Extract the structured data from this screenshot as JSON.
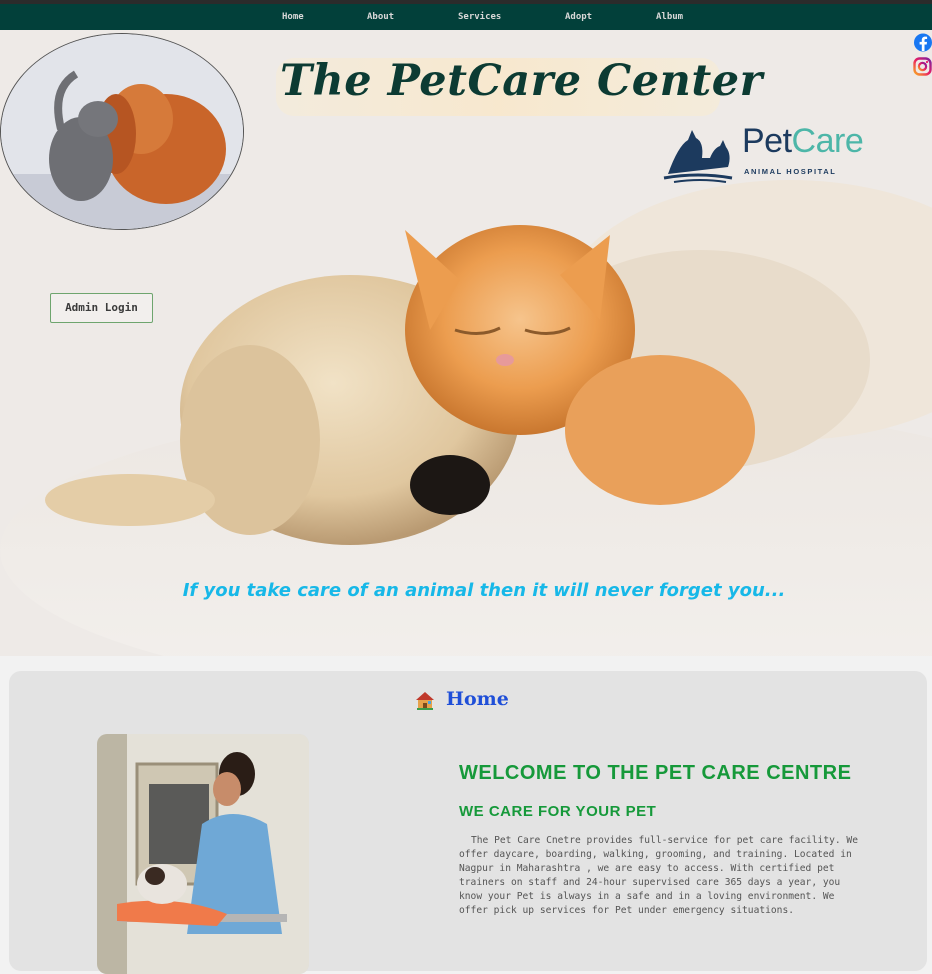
{
  "nav": {
    "items": [
      "Home",
      "About",
      "Services",
      "Adopt",
      "Album"
    ]
  },
  "header": {
    "title": "The PetCare Center",
    "logo_word_a": "Pet",
    "logo_word_b": "Care",
    "logo_sub": "ANIMAL HOSPITAL",
    "admin_login": "Admin Login",
    "tagline": "If you take care of an animal then it will never forget you..."
  },
  "colors": {
    "nav_bg": "#02403a",
    "title": "#0c3b33",
    "tagline": "#17b8e8",
    "section_title": "#1f4fd8",
    "welcome": "#16993a"
  },
  "social": [
    "facebook-icon",
    "instagram-icon"
  ],
  "main": {
    "section_title": "Home",
    "welcome_heading": "WELCOME TO THE PET CARE CENTRE",
    "welcome_sub": "WE CARE FOR YOUR PET",
    "description": "The Pet Care Cnetre provides full-service for pet care facility. We offer daycare, boarding, walking, grooming, and training. Located in Nagpur in Maharashtra , we are easy to access. With certified pet trainers on staff and 24-hour supervised care 365 days a year, you know your Pet is always in a safe and in a loving environment. We offer pick up services for Pet under emergency situations."
  }
}
